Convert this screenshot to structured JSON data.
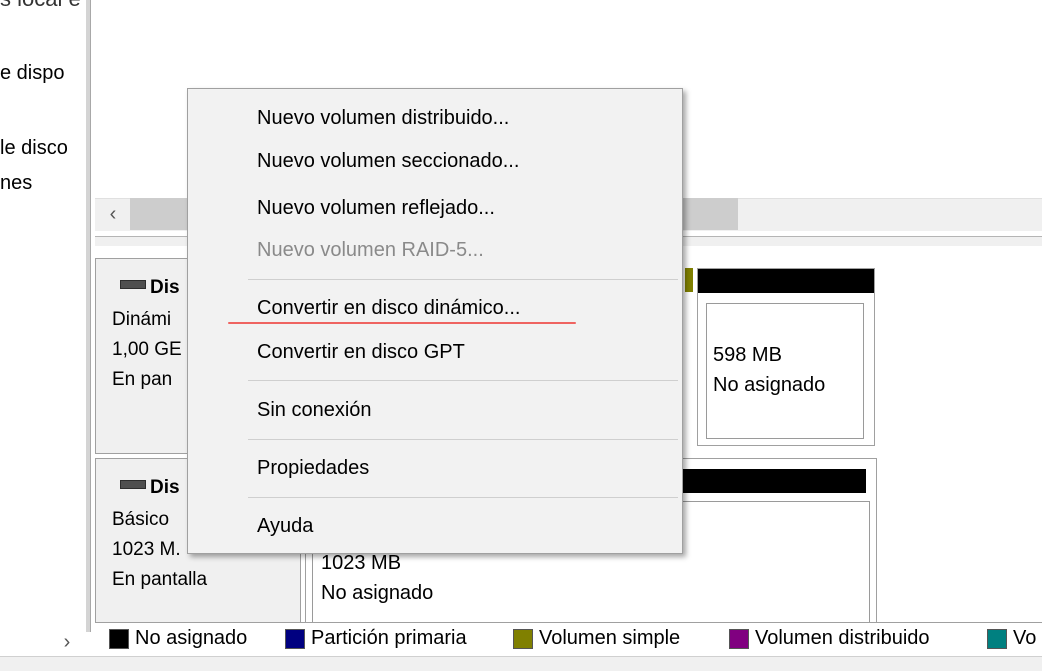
{
  "nav": {
    "top_cut": "s local    e nuevo disco y complete el formulario.",
    "items": [
      "e dispo",
      "le disco",
      "nes"
    ],
    "scroll_right": "›"
  },
  "list_pane": {
    "scroll_left": "‹"
  },
  "disks": [
    {
      "title": "Dis",
      "lines": [
        "Dinámi",
        "1,00 GE",
        "En pan"
      ],
      "partition": {
        "size": "598 MB",
        "state": "No asignado"
      }
    },
    {
      "title": "Dis",
      "lines": [
        "Básico",
        "1023 M.",
        "En pantalla"
      ],
      "partition": {
        "size": "1023 MB",
        "state": "No asignado"
      }
    }
  ],
  "legend": [
    {
      "label": "No asignado",
      "color": "#000000"
    },
    {
      "label": "Partición primaria",
      "color": "#000080"
    },
    {
      "label": "Volumen simple",
      "color": "#808000"
    },
    {
      "label": "Volumen distribuido",
      "color": "#800080"
    },
    {
      "label": "Vo",
      "color": "#008080"
    }
  ],
  "context_menu": {
    "items": [
      {
        "label": "Nuevo volumen distribuido...",
        "enabled": true
      },
      {
        "label": "Nuevo volumen seccionado...",
        "enabled": true
      },
      {
        "label": "Nuevo volumen reflejado...",
        "enabled": true
      },
      {
        "label": "Nuevo volumen RAID-5...",
        "enabled": false
      },
      {
        "label": "Convertir en disco dinámico...",
        "enabled": true
      },
      {
        "label": "Convertir en disco GPT",
        "enabled": true
      },
      {
        "label": "Sin conexión",
        "enabled": true
      },
      {
        "label": "Propiedades",
        "enabled": true
      },
      {
        "label": "Ayuda",
        "enabled": true
      }
    ]
  },
  "colors": {
    "highlight_underline": "#ef6461",
    "simple_volume_strip": "#808000"
  }
}
